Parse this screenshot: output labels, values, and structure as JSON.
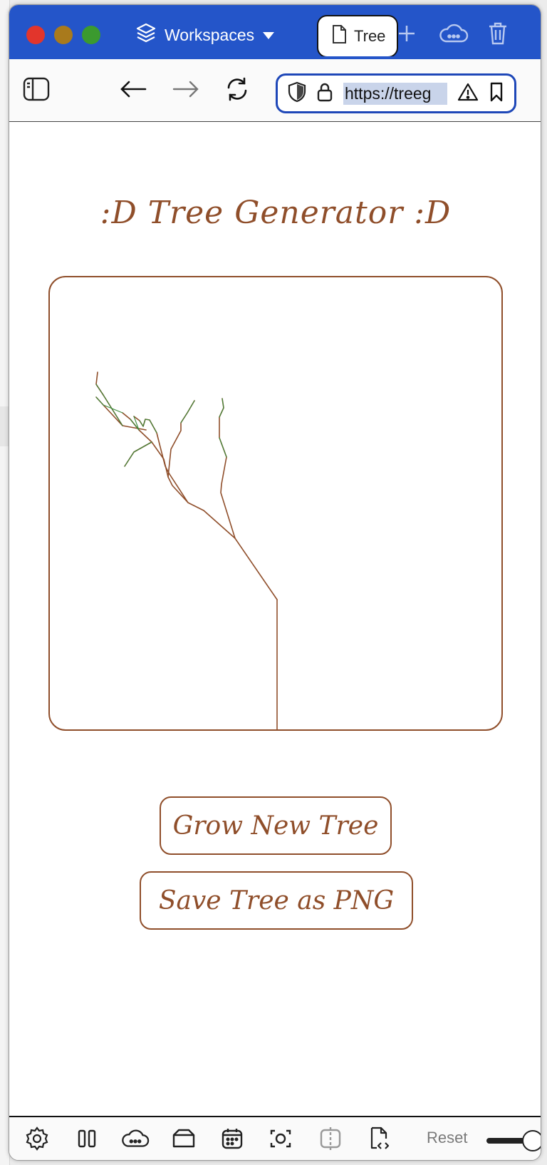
{
  "browser": {
    "workspaces_label": "Workspaces",
    "tab_title": "Tree",
    "url": "https://treeg"
  },
  "page": {
    "title": ":D Tree Generator :D",
    "grow_button": "Grow New Tree",
    "save_button": "Save Tree as PNG"
  },
  "bottombar": {
    "reset_label": "Reset"
  },
  "colors": {
    "accent": "#8f4e2a",
    "browser_blue": "#2455c9",
    "leaf_green": "#3a8a3a"
  }
}
